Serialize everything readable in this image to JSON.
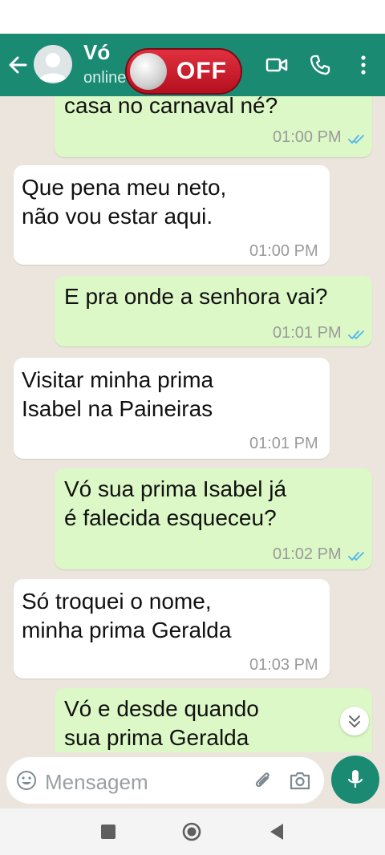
{
  "header": {
    "contact_name": "Vó",
    "contact_status": "online",
    "overlay_label": "OFF",
    "icons": [
      "back-arrow-icon",
      "avatar-icon",
      "video-call-icon",
      "phone-icon",
      "more-vert-icon"
    ]
  },
  "messages": [
    {
      "type": "out",
      "text": "casa no carnaval né?",
      "time": "01:00 PM",
      "read": true
    },
    {
      "type": "in",
      "text": "Que pena meu neto,\nnão vou estar aqui.",
      "time": "01:00 PM"
    },
    {
      "type": "out",
      "text": "E pra onde a senhora vai?",
      "time": "01:01 PM",
      "read": true
    },
    {
      "type": "in",
      "text": "Visitar minha prima\nIsabel na Paineiras",
      "time": "01:01 PM"
    },
    {
      "type": "out",
      "text": "Vó sua prima Isabel já\né falecida esqueceu?",
      "time": "01:02 PM",
      "read": true
    },
    {
      "type": "in",
      "text": "Só troquei o nome,\nminha prima Geralda",
      "time": "01:03 PM"
    },
    {
      "type": "out",
      "text": "Vó e desde quando\nsua prima Geralda",
      "time": "",
      "read": false
    }
  ],
  "composer": {
    "placeholder": "Mensagem",
    "icons": [
      "emoji-icon",
      "attach-icon",
      "camera-icon",
      "mic-icon"
    ]
  },
  "navbar": {
    "icons": [
      "recents-icon",
      "home-icon",
      "back-icon"
    ]
  },
  "colors": {
    "header": "#1a8a73",
    "chat_bg": "#ece5dd",
    "outgoing_bubble": "#dcf8c6",
    "incoming_bubble": "#ffffff",
    "read_tick": "#4fb6ec",
    "off_button": "#d0202f"
  }
}
